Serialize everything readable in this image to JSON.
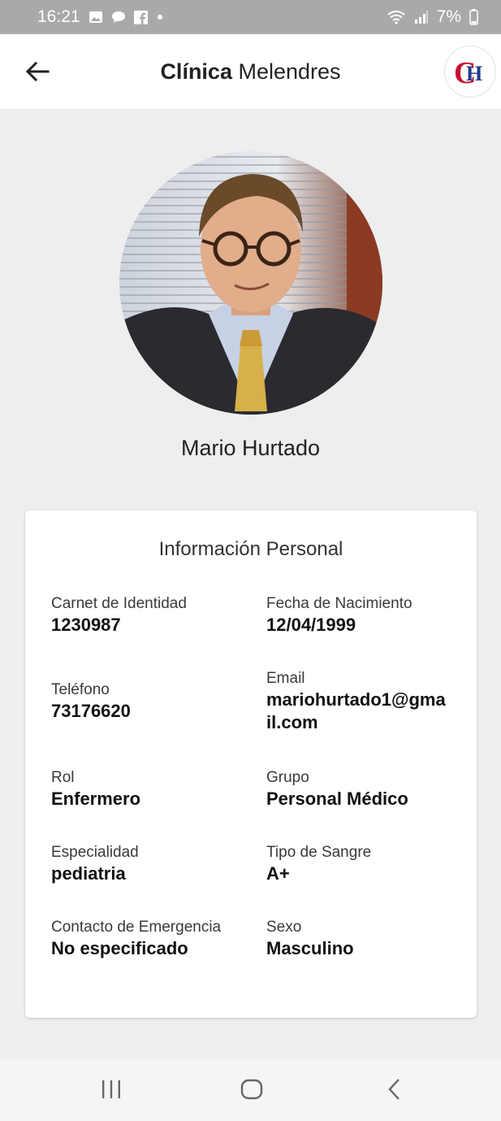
{
  "status_bar": {
    "time": "16:21",
    "battery": "7%",
    "left_icons": [
      "image-icon",
      "chat-icon",
      "facebook-icon",
      "dot-icon"
    ],
    "right_icons": [
      "wifi-icon",
      "signal-icon",
      "battery-icon"
    ]
  },
  "app_bar": {
    "title_bold": "Clínica",
    "title_regular": " Melendres",
    "logo_text": "CH"
  },
  "profile": {
    "name": "Mario Hurtado"
  },
  "card": {
    "title": "Información Personal",
    "fields": [
      {
        "label": "Carnet de Identidad",
        "value": "1230987"
      },
      {
        "label": "Fecha de Nacimiento",
        "value": "12/04/1999"
      },
      {
        "label": "Teléfono",
        "value": "73176620"
      },
      {
        "label": "Email",
        "value": "mariohurtado1@gmail.com"
      },
      {
        "label": "Rol",
        "value": "Enfermero"
      },
      {
        "label": "Grupo",
        "value": "Personal Médico"
      },
      {
        "label": "Especialidad",
        "value": "pediatria"
      },
      {
        "label": "Tipo de Sangre",
        "value": "A+"
      },
      {
        "label": "Contacto de Emergencia",
        "value": "No especificado"
      },
      {
        "label": "Sexo",
        "value": "Masculino"
      }
    ]
  },
  "nav_bar": {
    "buttons": [
      "recent-apps-icon",
      "home-icon",
      "back-icon"
    ]
  },
  "colors": {
    "background": "#eeeeee",
    "status_bar": "#a9a9a9",
    "logo_red": "#c8102e",
    "logo_blue": "#1e3a8a"
  }
}
